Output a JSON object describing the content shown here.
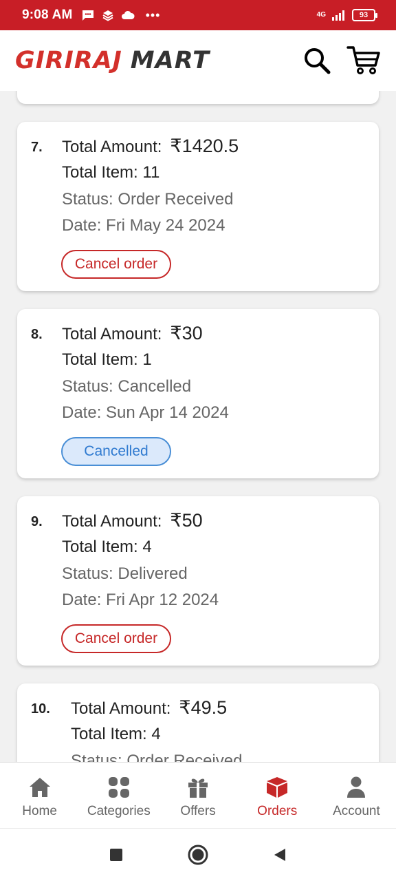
{
  "status_bar": {
    "time": "9:08 AM",
    "network": "4G",
    "battery": "93"
  },
  "header": {
    "logo_part1": "GIRIRAJ",
    "logo_part2": "MART"
  },
  "orders": [
    {
      "index": "7.",
      "amount_label": "Total Amount:",
      "amount": "₹1420.5",
      "items": "Total Item: 11",
      "status": "Status: Order Received",
      "date": "Date: Fri May 24 2024",
      "button": "Cancel order",
      "button_type": "cancel"
    },
    {
      "index": "8.",
      "amount_label": "Total Amount:",
      "amount": "₹30",
      "items": "Total Item: 1",
      "status": "Status: Cancelled",
      "date": "Date: Sun Apr 14 2024",
      "button": "Cancelled",
      "button_type": "cancelled"
    },
    {
      "index": "9.",
      "amount_label": "Total Amount:",
      "amount": "₹50",
      "items": "Total Item: 4",
      "status": "Status: Delivered",
      "date": "Date: Fri Apr 12 2024",
      "button": "Cancel order",
      "button_type": "cancel"
    },
    {
      "index": "10.",
      "amount_label": "Total Amount:",
      "amount": "₹49.5",
      "items": "Total Item: 4",
      "status": "Status: Order Received"
    }
  ],
  "bottom_nav": [
    {
      "label": "Home",
      "icon": "home-icon"
    },
    {
      "label": "Categories",
      "icon": "categories-icon"
    },
    {
      "label": "Offers",
      "icon": "gift-icon"
    },
    {
      "label": "Orders",
      "icon": "box-icon",
      "active": true
    },
    {
      "label": "Account",
      "icon": "user-icon"
    }
  ],
  "colors": {
    "brand_red": "#c81e26",
    "cancel_red": "#c62828",
    "cancelled_blue": "#2f7ad0"
  }
}
